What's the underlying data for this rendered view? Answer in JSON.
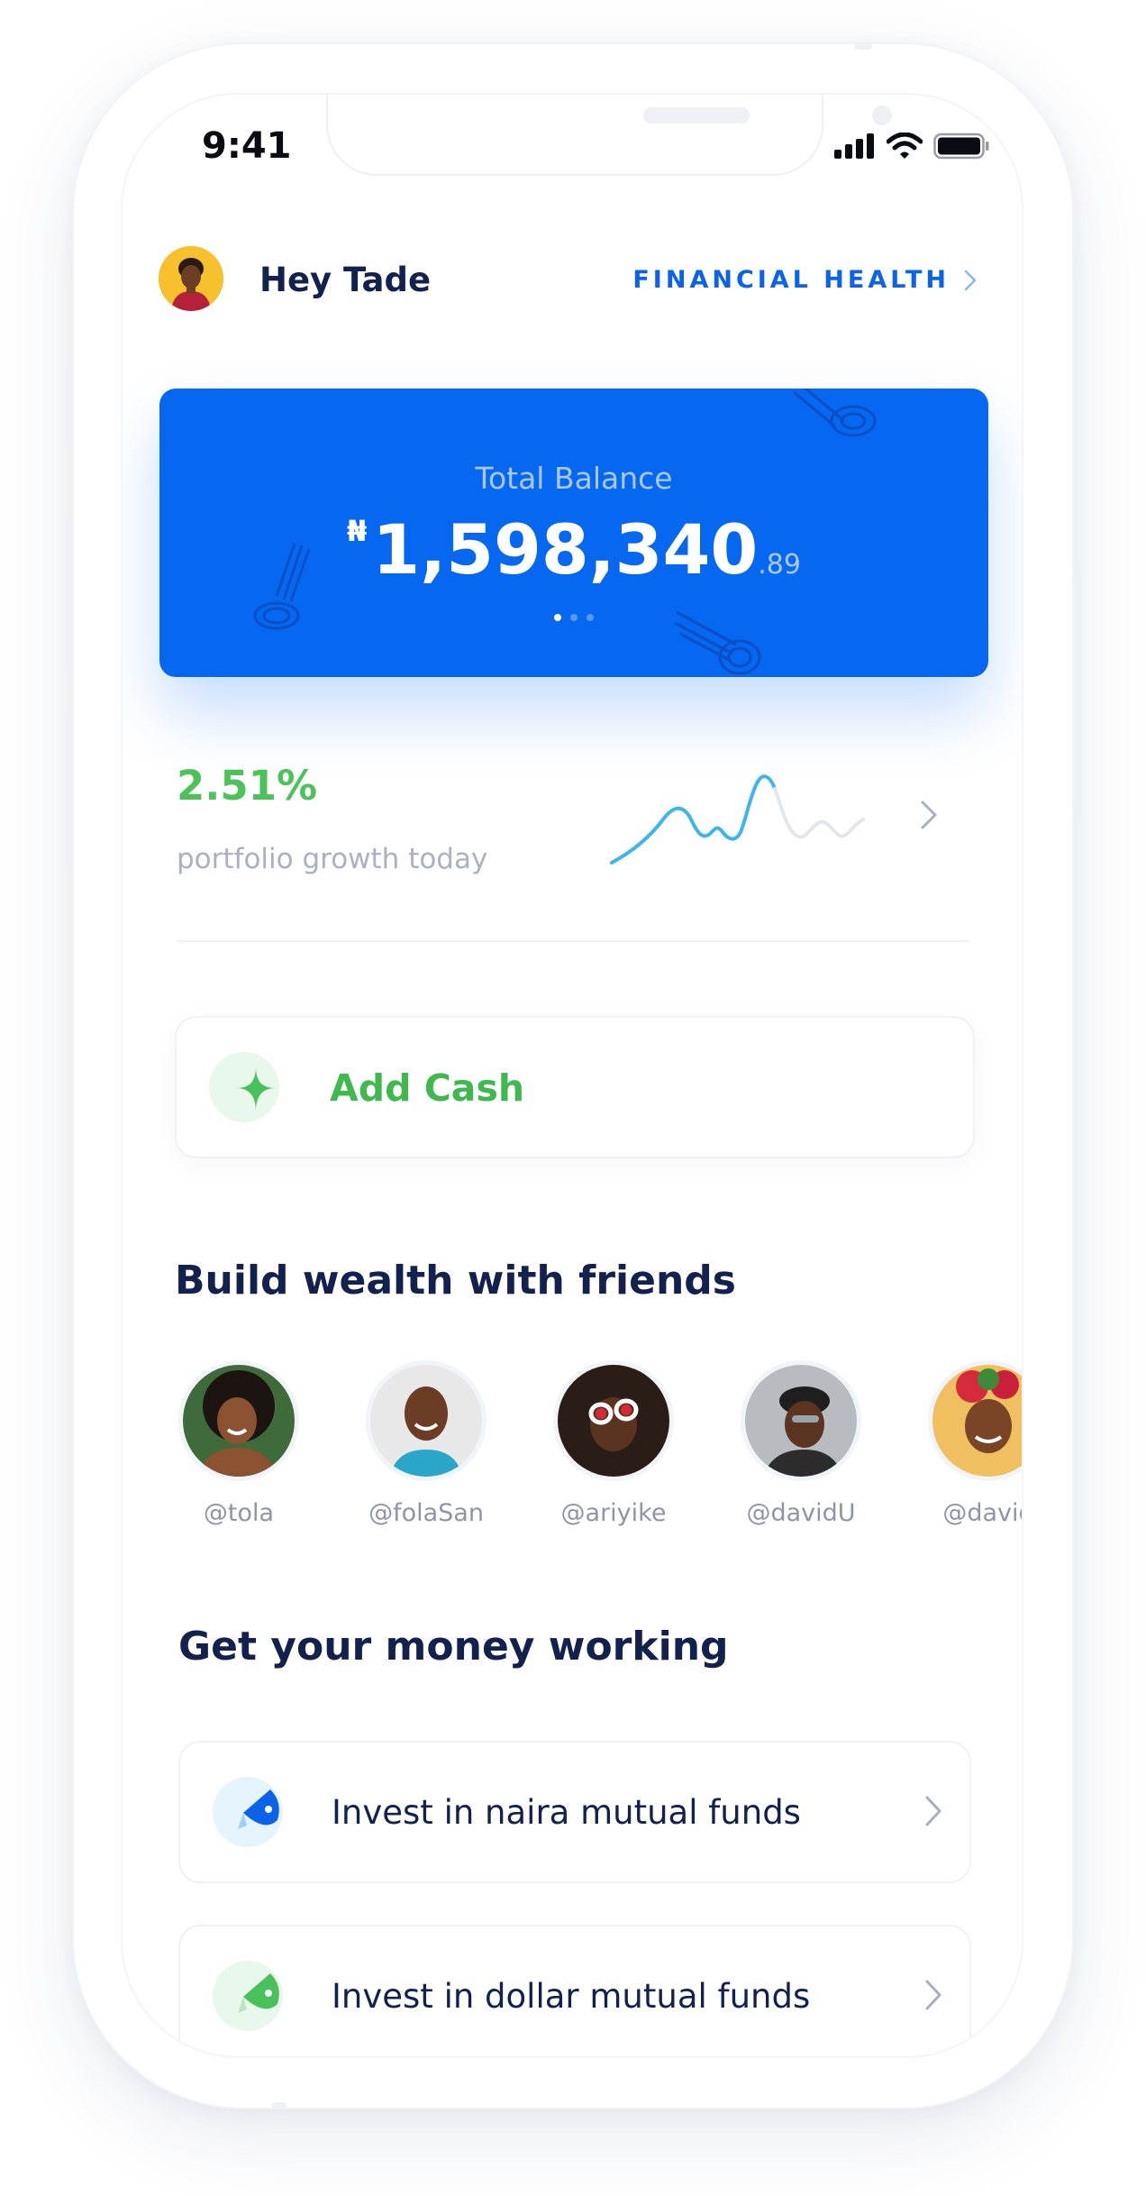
{
  "status_bar": {
    "time": "9:41"
  },
  "header": {
    "greeting": "Hey Tade",
    "financial_health": "FINANCIAL HEALTH"
  },
  "balance": {
    "label": "Total Balance",
    "currency": "₦",
    "amount": "1,598,340",
    "cents": ".89",
    "page_indicator": {
      "count": 3,
      "active": 1
    }
  },
  "growth": {
    "percent": "2.51%",
    "label": "portfolio growth today"
  },
  "add_cash": {
    "label": "Add Cash"
  },
  "friends": {
    "title": "Build wealth with friends",
    "items": [
      {
        "handle": "@tola"
      },
      {
        "handle": "@folaSan"
      },
      {
        "handle": "@ariyike"
      },
      {
        "handle": "@davidU"
      },
      {
        "handle": "@david"
      }
    ]
  },
  "money": {
    "title": "Get your money working",
    "items": [
      {
        "label": "Invest in naira mutual funds"
      },
      {
        "label": "Invest in dollar mutual funds"
      }
    ]
  },
  "colors": {
    "brand_blue": "#0667f0",
    "growth_green": "#4ec25a",
    "heading_navy": "#12214d"
  }
}
